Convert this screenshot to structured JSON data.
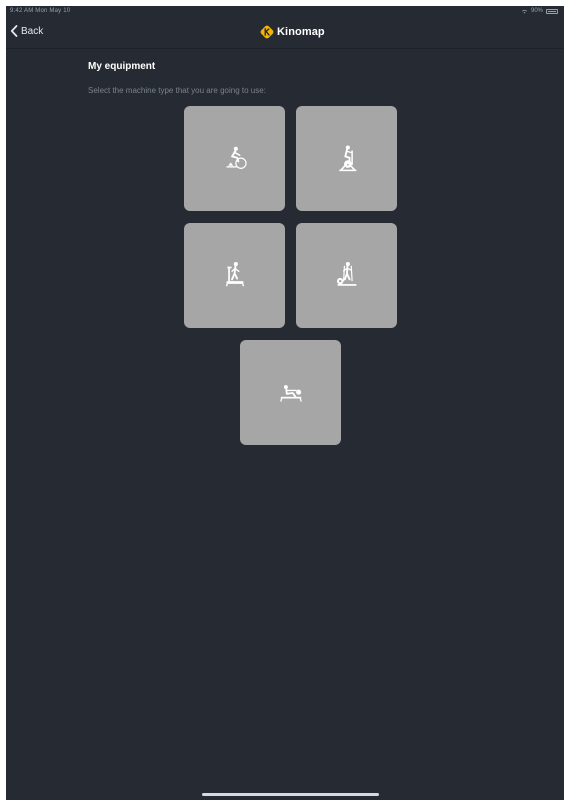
{
  "status_bar": {
    "time_date": "9:42 AM  Mon May 10",
    "battery": "90%",
    "icons": [
      "wifi-icon",
      "battery-icon"
    ]
  },
  "nav": {
    "back_label": "Back",
    "brand_name": "Kinomap",
    "icons": [
      "chevron-left-icon",
      "kinomap-logo-icon"
    ],
    "brand_color": "#f5b400"
  },
  "page": {
    "title": "My equipment",
    "subtitle": "Select the machine type that you are going to use:"
  },
  "equipment": [
    {
      "type": "Bike trainer",
      "icon": "bike-trainer-icon"
    },
    {
      "type": "Exercise bike",
      "icon": "exercise-bike-icon"
    },
    {
      "type": "Treadmill",
      "icon": "treadmill-icon"
    },
    {
      "type": "Elliptical",
      "icon": "elliptical-icon"
    },
    {
      "type": "Rowing machine",
      "icon": "rowing-machine-icon"
    }
  ],
  "colors": {
    "background": "#252a33",
    "tile": "#a6a6a6",
    "icon": "#ffffff",
    "subtitle": "#7b838e"
  }
}
